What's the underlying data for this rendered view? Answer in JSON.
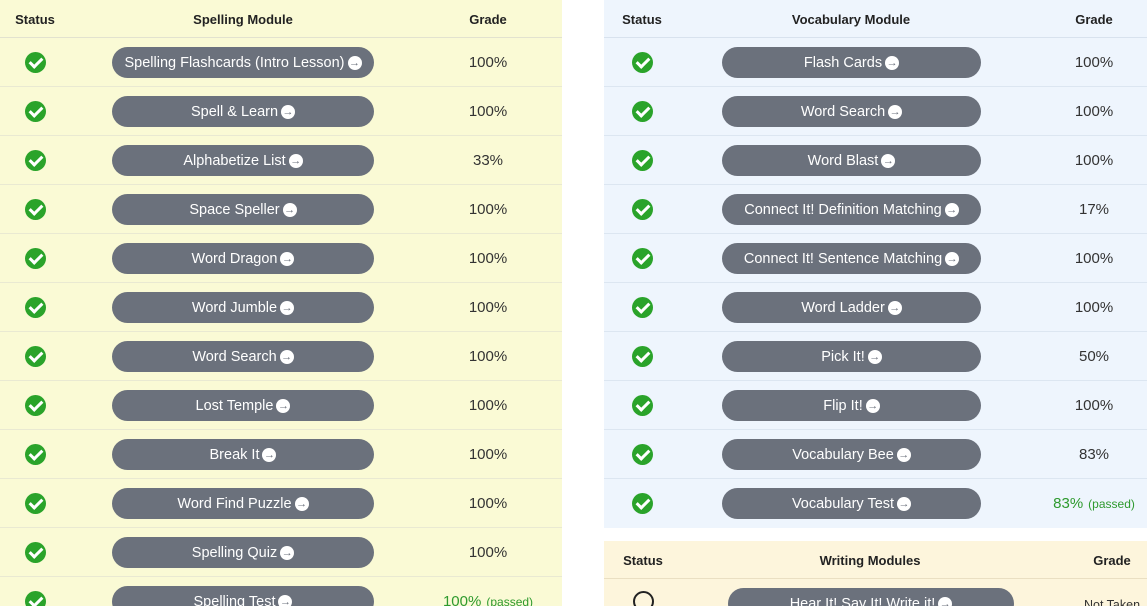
{
  "spelling": {
    "headers": {
      "status": "Status",
      "module": "Spelling Module",
      "grade": "Grade"
    },
    "rows": [
      {
        "label": "Spelling Flashcards (Intro Lesson)",
        "grade": "100%",
        "note": ""
      },
      {
        "label": "Spell & Learn",
        "grade": "100%",
        "note": ""
      },
      {
        "label": "Alphabetize List",
        "grade": "33%",
        "note": ""
      },
      {
        "label": "Space Speller",
        "grade": "100%",
        "note": ""
      },
      {
        "label": "Word Dragon",
        "grade": "100%",
        "note": ""
      },
      {
        "label": "Word Jumble",
        "grade": "100%",
        "note": ""
      },
      {
        "label": "Word Search",
        "grade": "100%",
        "note": ""
      },
      {
        "label": "Lost Temple",
        "grade": "100%",
        "note": ""
      },
      {
        "label": "Break It",
        "grade": "100%",
        "note": ""
      },
      {
        "label": "Word Find Puzzle",
        "grade": "100%",
        "note": ""
      },
      {
        "label": "Spelling Quiz",
        "grade": "100%",
        "note": ""
      },
      {
        "label": "Spelling Test",
        "grade": "100%",
        "note": "(passed)"
      }
    ]
  },
  "vocabulary": {
    "headers": {
      "status": "Status",
      "module": "Vocabulary Module",
      "grade": "Grade"
    },
    "rows": [
      {
        "label": "Flash Cards",
        "grade": "100%",
        "note": ""
      },
      {
        "label": "Word Search",
        "grade": "100%",
        "note": ""
      },
      {
        "label": "Word Blast",
        "grade": "100%",
        "note": ""
      },
      {
        "label": "Connect It! Definition Matching",
        "grade": "17%",
        "note": ""
      },
      {
        "label": "Connect It! Sentence Matching",
        "grade": "100%",
        "note": ""
      },
      {
        "label": "Word Ladder",
        "grade": "100%",
        "note": ""
      },
      {
        "label": "Pick It!",
        "grade": "50%",
        "note": ""
      },
      {
        "label": "Flip It!",
        "grade": "100%",
        "note": ""
      },
      {
        "label": "Vocabulary Bee",
        "grade": "83%",
        "note": ""
      },
      {
        "label": "Vocabulary Test",
        "grade": "83%",
        "note": "(passed)"
      }
    ]
  },
  "writing": {
    "headers": {
      "status": "Status",
      "module": "Writing Modules",
      "grade": "Grade"
    },
    "rows": [
      {
        "label": "Hear It! Say It! Write it!",
        "grade": "Not Taken",
        "note": ""
      }
    ]
  },
  "icons": {
    "complete": "check-circle-icon",
    "incomplete": "empty-circle-icon",
    "go": "arrow-right-circle-icon"
  },
  "colors": {
    "spelling_bg": "#fafad5",
    "vocab_bg": "#eef5fd",
    "writing_bg": "#fdf5dc",
    "button": "#6b717c",
    "check": "#2aa32a",
    "passed": "#2e9a2e"
  }
}
